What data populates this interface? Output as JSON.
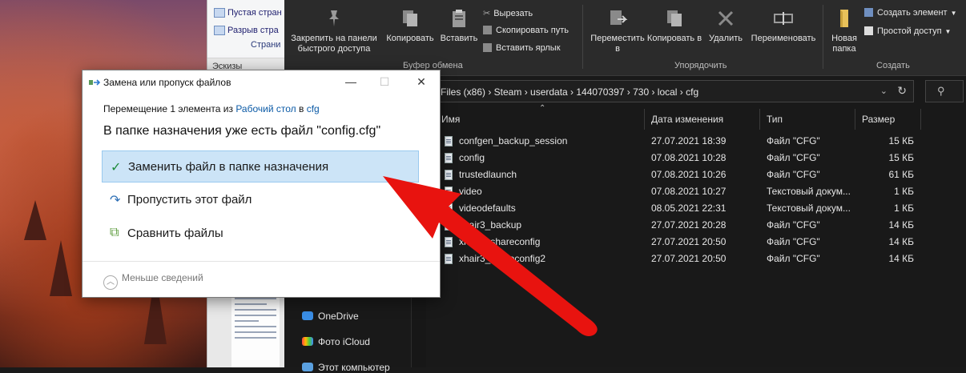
{
  "word": {
    "ribbon_items": [
      "Пустая стран",
      "Разрыв стра"
    ],
    "group_label": "Страни",
    "sidebar_label": "Эскизы"
  },
  "explorer": {
    "ribbon": {
      "pin_label": "Закрепить на панели быстрого доступа",
      "copy_label": "Копировать",
      "paste_label": "Вставить",
      "cut_label": "Вырезать",
      "copy_path_label": "Скопировать путь",
      "paste_shortcut_label": "Вставить ярлык",
      "clipboard_group": "Буфер обмена",
      "move_label": "Переместить в",
      "copyto_label": "Копировать в",
      "delete_label": "Удалить",
      "rename_label": "Переименовать",
      "organize_group": "Упорядочить",
      "new_folder_label": "Новая папка",
      "new_item_label": "Создать элемент",
      "easy_access_label": "Простой доступ",
      "create_group": "Создать"
    },
    "address": "Files (x86)  ›  Steam  ›  userdata  ›  144070397  ›  730  ›  local  ›  cfg",
    "columns": {
      "name": "Имя",
      "date": "Дата изменения",
      "type": "Тип",
      "size": "Размер"
    },
    "files": [
      {
        "name": "confgen_backup_session",
        "date": "27.07.2021 18:39",
        "type": "Файл \"CFG\"",
        "size": "15 КБ"
      },
      {
        "name": "config",
        "date": "07.08.2021 10:28",
        "type": "Файл \"CFG\"",
        "size": "15 КБ"
      },
      {
        "name": "trustedlaunch",
        "date": "07.08.2021 10:26",
        "type": "Файл \"CFG\"",
        "size": "61 КБ"
      },
      {
        "name": "video",
        "date": "07.08.2021 10:27",
        "type": "Текстовый докум...",
        "size": "1 КБ"
      },
      {
        "name": "videodefaults",
        "date": "08.05.2021 22:31",
        "type": "Текстовый докум...",
        "size": "1 КБ"
      },
      {
        "name": "xhair3_backup",
        "date": "27.07.2021 20:28",
        "type": "Файл \"CFG\"",
        "size": "14 КБ"
      },
      {
        "name": "xhair3_shareconfig",
        "date": "27.07.2021 20:50",
        "type": "Файл \"CFG\"",
        "size": "14 КБ"
      },
      {
        "name": "xhair3_shareconfig2",
        "date": "27.07.2021 20:50",
        "type": "Файл \"CFG\"",
        "size": "14 КБ"
      }
    ],
    "nav": [
      "OneDrive",
      "Фото iCloud",
      "Этот компьютер"
    ]
  },
  "dialog": {
    "title": "Замена или пропуск файлов",
    "line1_prefix": "Перемещение 1 элемента из ",
    "line1_src": "Рабочий стол",
    "line1_mid": " в ",
    "line1_dst": "cfg",
    "heading": "В папке назначения уже есть файл \"config.cfg\"",
    "options": [
      {
        "label": "Заменить файл в папке назначения"
      },
      {
        "label": "Пропустить этот файл"
      },
      {
        "label": "Сравнить файлы"
      }
    ],
    "less_details": "Меньше сведений"
  },
  "colors": {
    "accent_red": "#e8130f",
    "selection": "#cce4f7",
    "link": "#0b5aa6"
  }
}
